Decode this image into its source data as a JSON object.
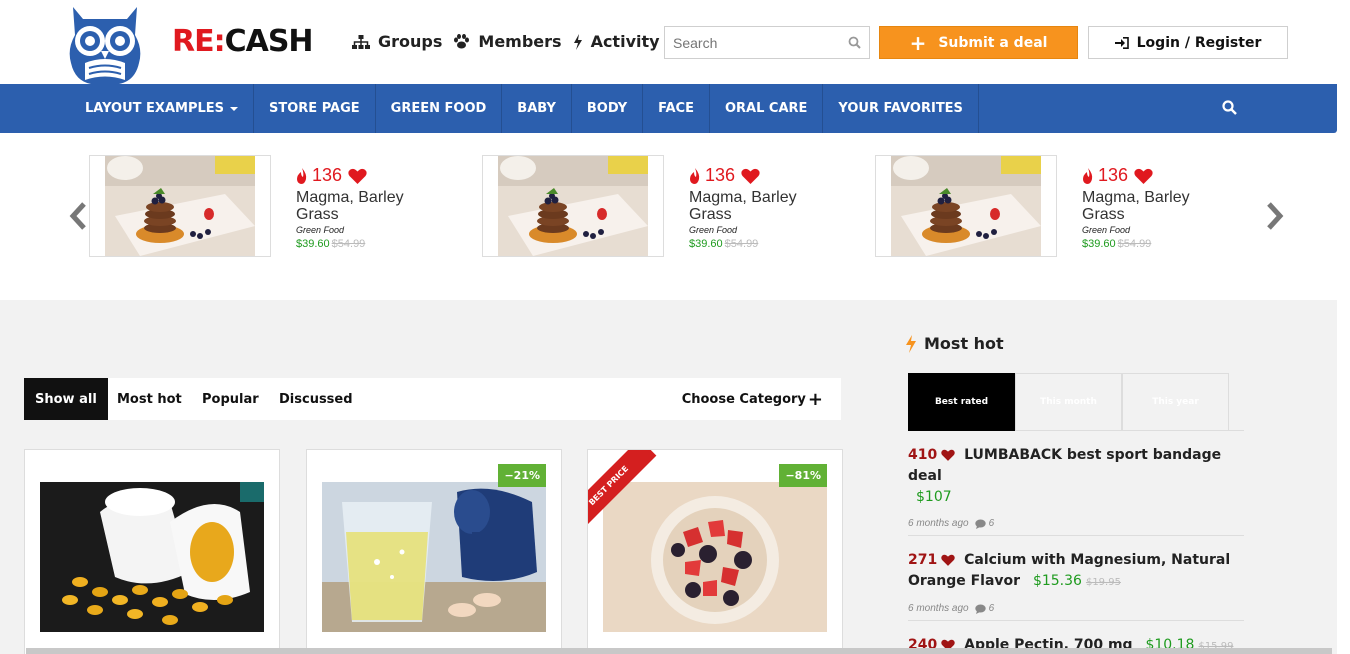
{
  "brand": {
    "logo_re": "RE",
    "logo_colon": ":",
    "logo_cash": "CASH",
    "accent": "#e0191f",
    "owl_color": "#2c5fae"
  },
  "top_links": [
    {
      "label": "Groups",
      "icon": "sitemap-icon"
    },
    {
      "label": "Members",
      "icon": "paw-icon"
    },
    {
      "label": "Activity",
      "icon": "bolt-icon"
    }
  ],
  "search": {
    "placeholder": "Search",
    "value": ""
  },
  "submit_button": {
    "label": "Submit a deal",
    "color": "#f7931e"
  },
  "login_button": {
    "label": "Login / Register"
  },
  "nav": {
    "color": "#2c5fae",
    "items": [
      {
        "label": "LAYOUT EXAMPLES",
        "dropdown": true
      },
      {
        "label": "STORE PAGE"
      },
      {
        "label": "GREEN FOOD"
      },
      {
        "label": "BABY"
      },
      {
        "label": "BODY"
      },
      {
        "label": "FACE"
      },
      {
        "label": "ORAL CARE"
      },
      {
        "label": "YOUR FAVORITES"
      }
    ]
  },
  "carousel": {
    "items": [
      {
        "hot": "136",
        "title": "Magma, Barley Grass",
        "category": "Green Food",
        "price": "$39.60",
        "old_price": "$54.99"
      },
      {
        "hot": "136",
        "title": "Magma, Barley Grass",
        "category": "Green Food",
        "price": "$39.60",
        "old_price": "$54.99"
      },
      {
        "hot": "136",
        "title": "Magma, Barley Grass",
        "category": "Green Food",
        "price": "$39.60",
        "old_price": "$54.99"
      }
    ]
  },
  "filters": {
    "tabs": [
      "Show all",
      "Most hot",
      "Popular",
      "Discussed"
    ],
    "active": "Show all",
    "category_label": "Choose Category"
  },
  "deals": [
    {
      "image": "fish-oil-capsules",
      "discount": "",
      "ribbon": ""
    },
    {
      "image": "fizzy-water-dumbbell",
      "discount": "−21%",
      "ribbon": ""
    },
    {
      "image": "berries-bowl",
      "discount": "−81%",
      "ribbon": "BEST PRICE"
    }
  ],
  "sidebar": {
    "title": "Most hot",
    "tabs": [
      "Best rated",
      "This month",
      "This year"
    ],
    "active_tab": "Best rated",
    "items": [
      {
        "count": "410",
        "title": "LUMBABACK best sport bandage deal",
        "price": "$107",
        "old_price": "",
        "time": "6 months ago",
        "comments": "6"
      },
      {
        "count": "271",
        "title": "Calcium with Magnesium, Natural Orange Flavor",
        "price": "$15.36",
        "old_price": "$19.95",
        "time": "6 months ago",
        "comments": "6"
      },
      {
        "count": "240",
        "title": "Apple Pectin, 700 mg",
        "price": "$10.18",
        "old_price": "$15.99",
        "time": "",
        "comments": ""
      }
    ]
  }
}
